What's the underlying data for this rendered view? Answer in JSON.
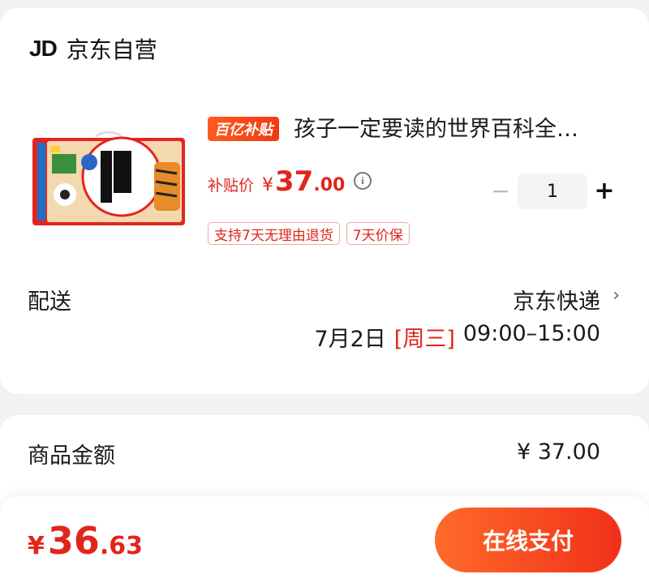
{
  "seller": {
    "logo": "JD",
    "name": "京东自营"
  },
  "product": {
    "badge": "百亿补贴",
    "title": "孩子一定要读的世界百科全…",
    "image_icon": "book-box-image",
    "price_label": "补贴价",
    "currency": "¥",
    "price_int": "37",
    "price_dec": ".00",
    "quantity": "1",
    "minus": "−",
    "plus": "+",
    "tags": [
      "支持7天无理由退货",
      "7天价保"
    ]
  },
  "delivery": {
    "label": "配送",
    "carrier": "京东快递",
    "date": "7月2日",
    "weekday": "[周三]",
    "time": "09:00–15:00"
  },
  "summary": {
    "label": "商品金额",
    "value": "¥ 37.00"
  },
  "footer": {
    "currency": "¥",
    "total_int": "36",
    "total_dec": ".63",
    "pay_label": "在线支付"
  },
  "colors": {
    "accent": "#e1251b",
    "button": "#f0301a"
  }
}
